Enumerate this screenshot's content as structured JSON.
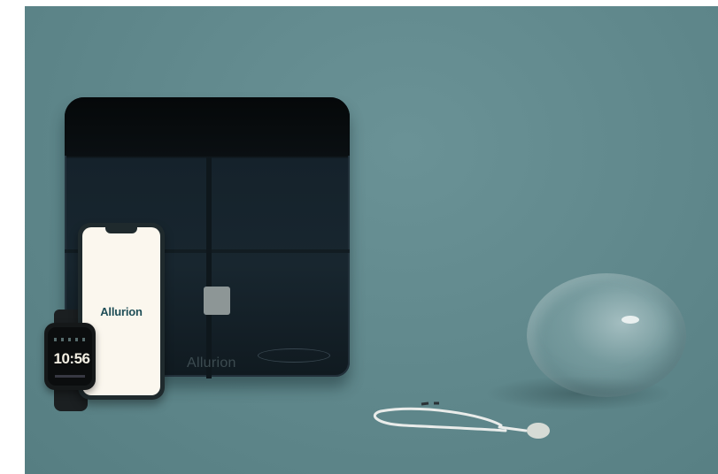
{
  "scale": {
    "brand_label": "Allurion"
  },
  "phone": {
    "app_logo": "Allurion"
  },
  "watch": {
    "time": "10:56"
  },
  "colors": {
    "background": "#5f878b",
    "scale_glass": "#18262f",
    "phone_screen": "#fbf7ee",
    "brand_teal": "#1f4e57"
  }
}
